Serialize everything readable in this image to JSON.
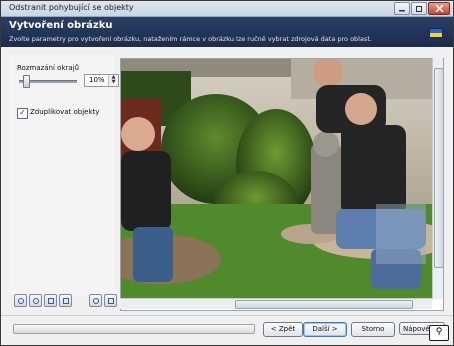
{
  "window": {
    "title": "Odstranit pohybující se objekty",
    "icons": {
      "minimize": "minimize-icon",
      "maximize": "maximize-icon",
      "close": "close-icon"
    }
  },
  "banner": {
    "heading": "Vytvoření obrázku",
    "subtitle": "Zvolte parametry pro vytvoření obrázku, natažením rámce v obrázku lze ručně vybrat zdrojová data pro oblast.",
    "icon": "language-flag-icon"
  },
  "left_panel": {
    "blur_label": "Rozmazání okrajů",
    "blur_value": "10%",
    "duplicate_label": "Zduplikovat objekty",
    "duplicate_checked": true,
    "tool_buttons": [
      "zoom-in-icon",
      "zoom-out-icon",
      "fit-icon",
      "actual-size-icon",
      "hand-icon",
      "select-rect-icon"
    ]
  },
  "buttons": {
    "back": "< Zpět",
    "next": "Další >",
    "cancel": "Storno",
    "help": "Nápověda"
  },
  "colors": {
    "banner": "#1f3054",
    "accent": "#3d7bbf"
  }
}
